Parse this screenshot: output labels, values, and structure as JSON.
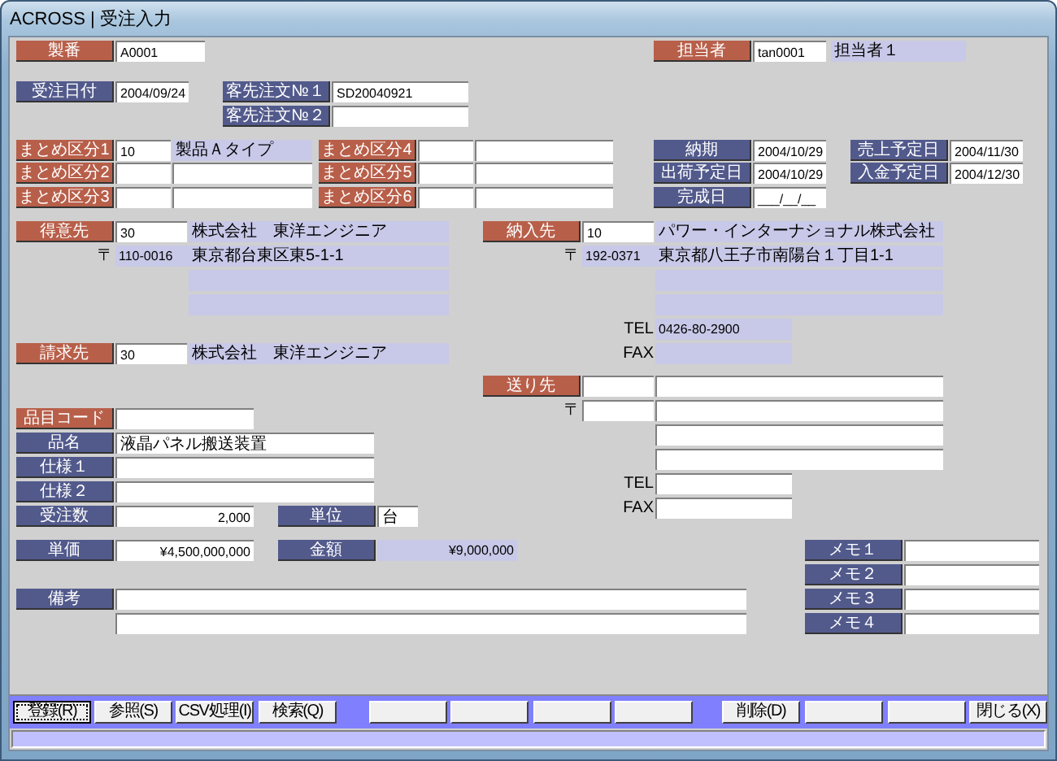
{
  "window": {
    "title": "ACROSS | 受注入力"
  },
  "fields": [
    {
      "kind": "label",
      "text": "製番",
      "color": "#b85f4a"
    },
    {
      "kind": "input",
      "value": "A0001"
    },
    {
      "kind": "label",
      "text": "担当者",
      "color": "#b85f4a"
    },
    {
      "kind": "input",
      "value": "tan0001"
    },
    {
      "kind": "display",
      "text": "担当者１"
    },
    {
      "kind": "label",
      "text": "受注日付",
      "color": "#525a8c"
    },
    {
      "kind": "input",
      "value": "2004/09/24"
    },
    {
      "kind": "label",
      "text": "客先注文№１",
      "color": "#525a8c"
    },
    {
      "kind": "input",
      "value": "SD20040921"
    },
    {
      "kind": "label",
      "text": "客先注文№２",
      "color": "#525a8c"
    },
    {
      "kind": "input"
    },
    {
      "kind": "label",
      "text": "まとめ区分1",
      "color": "#b85f4a"
    },
    {
      "kind": "input",
      "value": "10"
    },
    {
      "kind": "display",
      "text": "製品Ａタイプ"
    },
    {
      "kind": "label",
      "text": "まとめ区分4",
      "color": "#b85f4a"
    },
    {
      "kind": "input"
    },
    {
      "kind": "input"
    },
    {
      "kind": "label",
      "text": "納期",
      "color": "#525a8c"
    },
    {
      "kind": "input",
      "value": "2004/10/29"
    },
    {
      "kind": "label",
      "text": "売上予定日",
      "color": "#525a8c"
    },
    {
      "kind": "input",
      "value": "2004/11/30"
    },
    {
      "kind": "label",
      "text": "まとめ区分2",
      "color": "#b85f4a"
    },
    {
      "kind": "input"
    },
    {
      "kind": "input"
    },
    {
      "kind": "label",
      "text": "まとめ区分5",
      "color": "#b85f4a"
    },
    {
      "kind": "input"
    },
    {
      "kind": "input"
    },
    {
      "kind": "label",
      "text": "出荷予定日",
      "color": "#525a8c"
    },
    {
      "kind": "input",
      "value": "2004/10/29"
    },
    {
      "kind": "label",
      "text": "入金予定日",
      "color": "#525a8c"
    },
    {
      "kind": "input",
      "value": "2004/12/30"
    },
    {
      "kind": "label",
      "text": "まとめ区分3",
      "color": "#b85f4a"
    },
    {
      "kind": "input"
    },
    {
      "kind": "input"
    },
    {
      "kind": "label",
      "text": "まとめ区分6",
      "color": "#b85f4a"
    },
    {
      "kind": "input"
    },
    {
      "kind": "input"
    },
    {
      "kind": "label",
      "text": "完成日",
      "color": "#525a8c"
    },
    {
      "kind": "input",
      "value": "___/__/__"
    },
    {
      "kind": "label",
      "text": "得意先",
      "color": "#b85f4a"
    },
    {
      "kind": "input",
      "value": "30"
    },
    {
      "kind": "display",
      "text": "株式会社　東洋エンジニア"
    },
    {
      "kind": "label",
      "text": "納入先",
      "color": "#b85f4a"
    },
    {
      "kind": "input",
      "value": "10"
    },
    {
      "kind": "display",
      "text": "パワー・インターナショナル株式会社"
    },
    {
      "kind": "caption",
      "text": "〒"
    },
    {
      "kind": "display",
      "text": "110-0016"
    },
    {
      "kind": "display",
      "text": "東京都台東区東5-1-1"
    },
    {
      "kind": "caption",
      "text": "〒"
    },
    {
      "kind": "display",
      "text": "192-0371"
    },
    {
      "kind": "display",
      "text": "東京都八王子市南陽台１丁目1-1"
    },
    {
      "kind": "display"
    },
    {
      "kind": "display"
    },
    {
      "kind": "display"
    },
    {
      "kind": "display"
    },
    {
      "kind": "caption",
      "text": "TEL"
    },
    {
      "kind": "display",
      "text": "0426-80-2900"
    },
    {
      "kind": "label",
      "text": "請求先",
      "color": "#b85f4a"
    },
    {
      "kind": "input",
      "value": "30"
    },
    {
      "kind": "display",
      "text": "株式会社　東洋エンジニア"
    },
    {
      "kind": "caption",
      "text": "FAX"
    },
    {
      "kind": "display"
    },
    {
      "kind": "label",
      "text": "送り先",
      "color": "#b85f4a"
    },
    {
      "kind": "input"
    },
    {
      "kind": "input"
    },
    {
      "kind": "caption",
      "text": "〒"
    },
    {
      "kind": "input"
    },
    {
      "kind": "input"
    },
    {
      "kind": "label",
      "text": "品目コード",
      "color": "#b85f4a"
    },
    {
      "kind": "input"
    },
    {
      "kind": "input"
    },
    {
      "kind": "label",
      "text": "品名",
      "color": "#525a8c"
    },
    {
      "kind": "input",
      "value": "液晶パネル搬送装置"
    },
    {
      "kind": "input"
    },
    {
      "kind": "label",
      "text": "仕様１",
      "color": "#525a8c"
    },
    {
      "kind": "input"
    },
    {
      "kind": "caption",
      "text": "TEL"
    },
    {
      "kind": "input"
    },
    {
      "kind": "label",
      "text": "仕様２",
      "color": "#525a8c"
    },
    {
      "kind": "input"
    },
    {
      "kind": "caption",
      "text": "FAX"
    },
    {
      "kind": "input"
    },
    {
      "kind": "label",
      "text": "受注数",
      "color": "#525a8c"
    },
    {
      "kind": "input",
      "value": "2,000"
    },
    {
      "kind": "label",
      "text": "単位",
      "color": "#525a8c"
    },
    {
      "kind": "input",
      "value": "台"
    },
    {
      "kind": "label",
      "text": "単価",
      "color": "#525a8c"
    },
    {
      "kind": "input",
      "value": "¥4,500,000,000"
    },
    {
      "kind": "label",
      "text": "金額",
      "color": "#525a8c"
    },
    {
      "kind": "display",
      "text": "¥9,000,000"
    },
    {
      "kind": "label",
      "text": "メモ１",
      "color": "#525a8c"
    },
    {
      "kind": "input"
    },
    {
      "kind": "label",
      "text": "メモ２",
      "color": "#525a8c"
    },
    {
      "kind": "input"
    },
    {
      "kind": "label",
      "text": "備考",
      "color": "#525a8c"
    },
    {
      "kind": "input"
    },
    {
      "kind": "label",
      "text": "メモ３",
      "color": "#525a8c"
    },
    {
      "kind": "input"
    },
    {
      "kind": "input"
    },
    {
      "kind": "label",
      "text": "メモ４",
      "color": "#525a8c"
    },
    {
      "kind": "input"
    }
  ],
  "toolbar": [
    {
      "kind": "button",
      "label": "登録(R)",
      "focused": true
    },
    {
      "kind": "button",
      "label": "参照(S)",
      "focused": false
    },
    {
      "kind": "button",
      "label": "CSV処理(I)",
      "focused": false
    },
    {
      "kind": "button",
      "label": "検索(Q)",
      "focused": false
    },
    {
      "kind": "blank"
    },
    {
      "kind": "blank"
    },
    {
      "kind": "blank"
    },
    {
      "kind": "blank"
    },
    {
      "kind": "button",
      "label": "削除(D)",
      "focused": false
    },
    {
      "kind": "blank"
    },
    {
      "kind": "blank"
    },
    {
      "kind": "button",
      "label": "閉じる(X)",
      "focused": false
    }
  ]
}
